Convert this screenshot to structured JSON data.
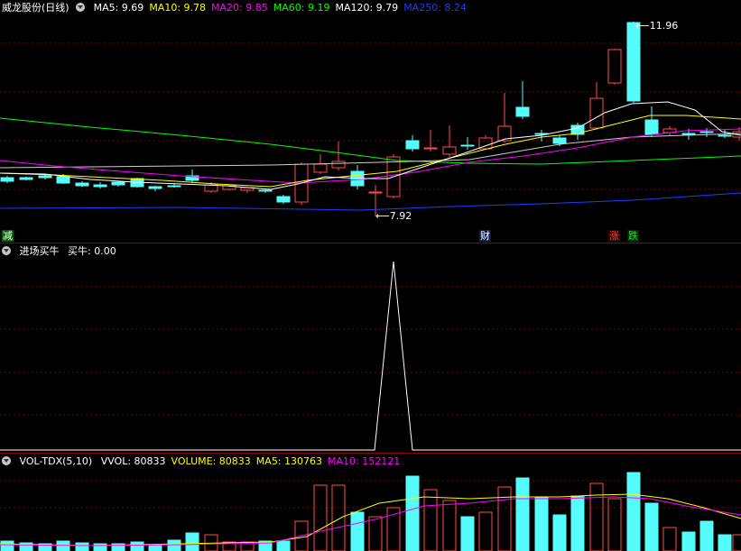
{
  "main": {
    "stock_name": "威龙股份(日线)",
    "indicators": [
      {
        "label": "MA5: 9.69",
        "color": "#ffffff"
      },
      {
        "label": "MA10: 9.78",
        "color": "#ffff00"
      },
      {
        "label": "MA20: 9.85",
        "color": "#ff00ff"
      },
      {
        "label": "MA60: 9.19",
        "color": "#00ff00"
      },
      {
        "label": "MA120: 9.79",
        "color": "#ffffff"
      },
      {
        "label": "MA250: 8.24",
        "color": "#1e3cff"
      }
    ],
    "high_label": "11.96",
    "low_label": "7.92",
    "markers": [
      {
        "text": "减",
        "color": "#ffffff",
        "bg": "#006400"
      },
      {
        "text": "财",
        "color": "#ffffff",
        "bg": "#0a1a5a"
      },
      {
        "text": "涨",
        "color": "#ff4040",
        "bg": "#2a0000"
      },
      {
        "text": "跌",
        "color": "#00ff00",
        "bg": "#002a00"
      }
    ]
  },
  "indicator_panel": {
    "name": "进场买牛",
    "value_label": "买牛: 0.00"
  },
  "volume_panel": {
    "name": "VOL-TDX(5,10)",
    "items": [
      {
        "label": "VVOL: 80833",
        "color": "#ffffff"
      },
      {
        "label": "VOLUME: 80833",
        "color": "#ffff00"
      },
      {
        "label": "MA5: 130763",
        "color": "#ffff00"
      },
      {
        "label": "MA10: 152121",
        "color": "#ff00ff"
      }
    ]
  },
  "colors": {
    "up": "#ff4c4c",
    "down": "#54fcfc",
    "grid": "#800000"
  }
}
